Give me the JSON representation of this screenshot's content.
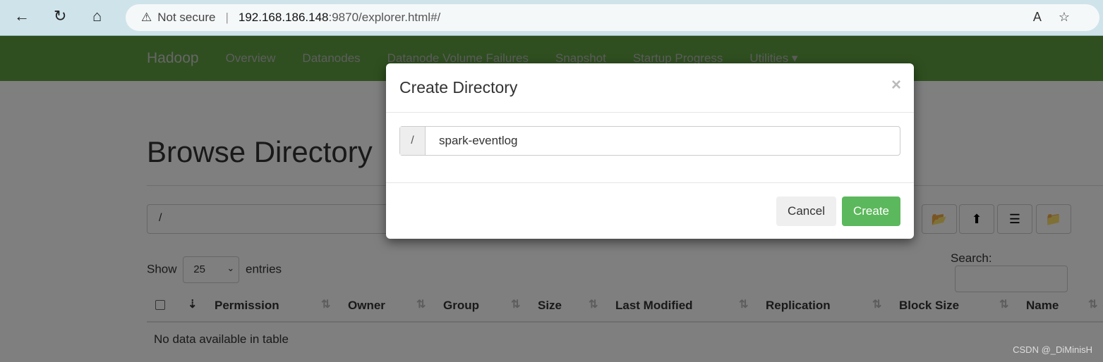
{
  "browser": {
    "security": "Not secure",
    "url_host": "192.168.186.148",
    "url_rest": ":9870/explorer.html#/"
  },
  "navbar": {
    "brand": "Hadoop",
    "items": [
      "Overview",
      "Datanodes",
      "Datanode Volume Failures",
      "Snapshot",
      "Startup Progress",
      "Utilities ▾"
    ]
  },
  "page": {
    "title": "Browse Directory",
    "path": "/",
    "show": "Show",
    "entries_value": "25",
    "entries": "entries",
    "search": "Search:",
    "columns": [
      "Permission",
      "Owner",
      "Group",
      "Size",
      "Last Modified",
      "Replication",
      "Block Size",
      "Name"
    ],
    "empty": "No data available in table"
  },
  "modal": {
    "title": "Create Directory",
    "close": "×",
    "prefix": "/",
    "value": "spark-eventlog",
    "cancel": "Cancel",
    "create": "Create"
  },
  "watermark": "CSDN @_DiMinisH"
}
